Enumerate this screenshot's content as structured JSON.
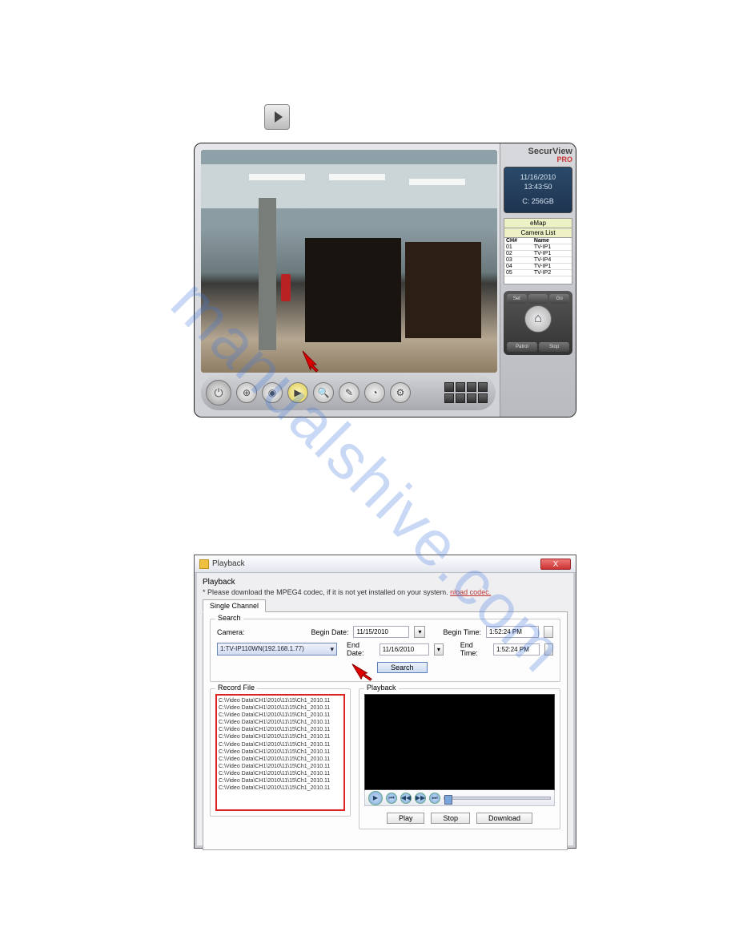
{
  "watermark": "manualshive.com",
  "securview": {
    "brand": "SecurView",
    "brand_sub": "PRO",
    "clock_date": "11/16/2010",
    "clock_time": "13:43:50",
    "clock_disk": "C: 256GB",
    "emap": "eMap",
    "camlist_title": "Camera List",
    "camlist_head_ch": "CH#",
    "camlist_head_name": "Name",
    "cameras": [
      {
        "ch": "01",
        "name": "TV-IP1"
      },
      {
        "ch": "02",
        "name": "TV-IP1"
      },
      {
        "ch": "03",
        "name": "TV-IP4"
      },
      {
        "ch": "04",
        "name": "TV-IP1"
      },
      {
        "ch": "05",
        "name": "TV-IP2"
      }
    ],
    "rctrl_set": "Set",
    "rctrl_go": "Go",
    "rctrl_patrol": "Patrol",
    "rctrl_stop": "Stop"
  },
  "playback": {
    "window_title": "Playback",
    "menu_playback": "Playback",
    "notice_prefix": "* Please download the MPEG4 codec, if it is not yet installed on your system. ",
    "notice_link": "nload codec.",
    "tab_single": "Single Channel",
    "group_search": "Search",
    "label_camera": "Camera:",
    "camera_value": "1:TV-IP110WN(192.168.1.77)",
    "label_begin_date": "Begin Date:",
    "begin_date": "11/15/2010",
    "label_end_date": "End Date:",
    "end_date": "11/16/2010",
    "label_begin_time": "Begin Time:",
    "begin_time": "1:52:24 PM",
    "label_end_time": "End Time:",
    "end_time": "1:52:24 PM",
    "btn_search": "Search",
    "group_recfile": "Record File",
    "group_playback": "Playback",
    "files": [
      "C:\\Video Data\\CH1\\2010\\11\\15\\Ch1_2010.11",
      "C:\\Video Data\\CH1\\2010\\11\\15\\Ch1_2010.11",
      "C:\\Video Data\\CH1\\2010\\11\\15\\Ch1_2010.11",
      "C:\\Video Data\\CH1\\2010\\11\\15\\Ch1_2010.11",
      "C:\\Video Data\\CH1\\2010\\11\\15\\Ch1_2010.11",
      "C:\\Video Data\\CH1\\2010\\11\\15\\Ch1_2010.11",
      "C:\\Video Data\\CH1\\2010\\11\\15\\Ch1_2010.11",
      "C:\\Video Data\\CH1\\2010\\11\\15\\Ch1_2010.11",
      "C:\\Video Data\\CH1\\2010\\11\\15\\Ch1_2010.11",
      "C:\\Video Data\\CH1\\2010\\11\\15\\Ch1_2010.11",
      "C:\\Video Data\\CH1\\2010\\11\\15\\Ch1_2010.11",
      "C:\\Video Data\\CH1\\2010\\11\\15\\Ch1_2010.11",
      "C:\\Video Data\\CH1\\2010\\11\\15\\Ch1_2010.11"
    ],
    "btn_play": "Play",
    "btn_stop": "Stop",
    "btn_download": "Download",
    "close_x": "X"
  }
}
